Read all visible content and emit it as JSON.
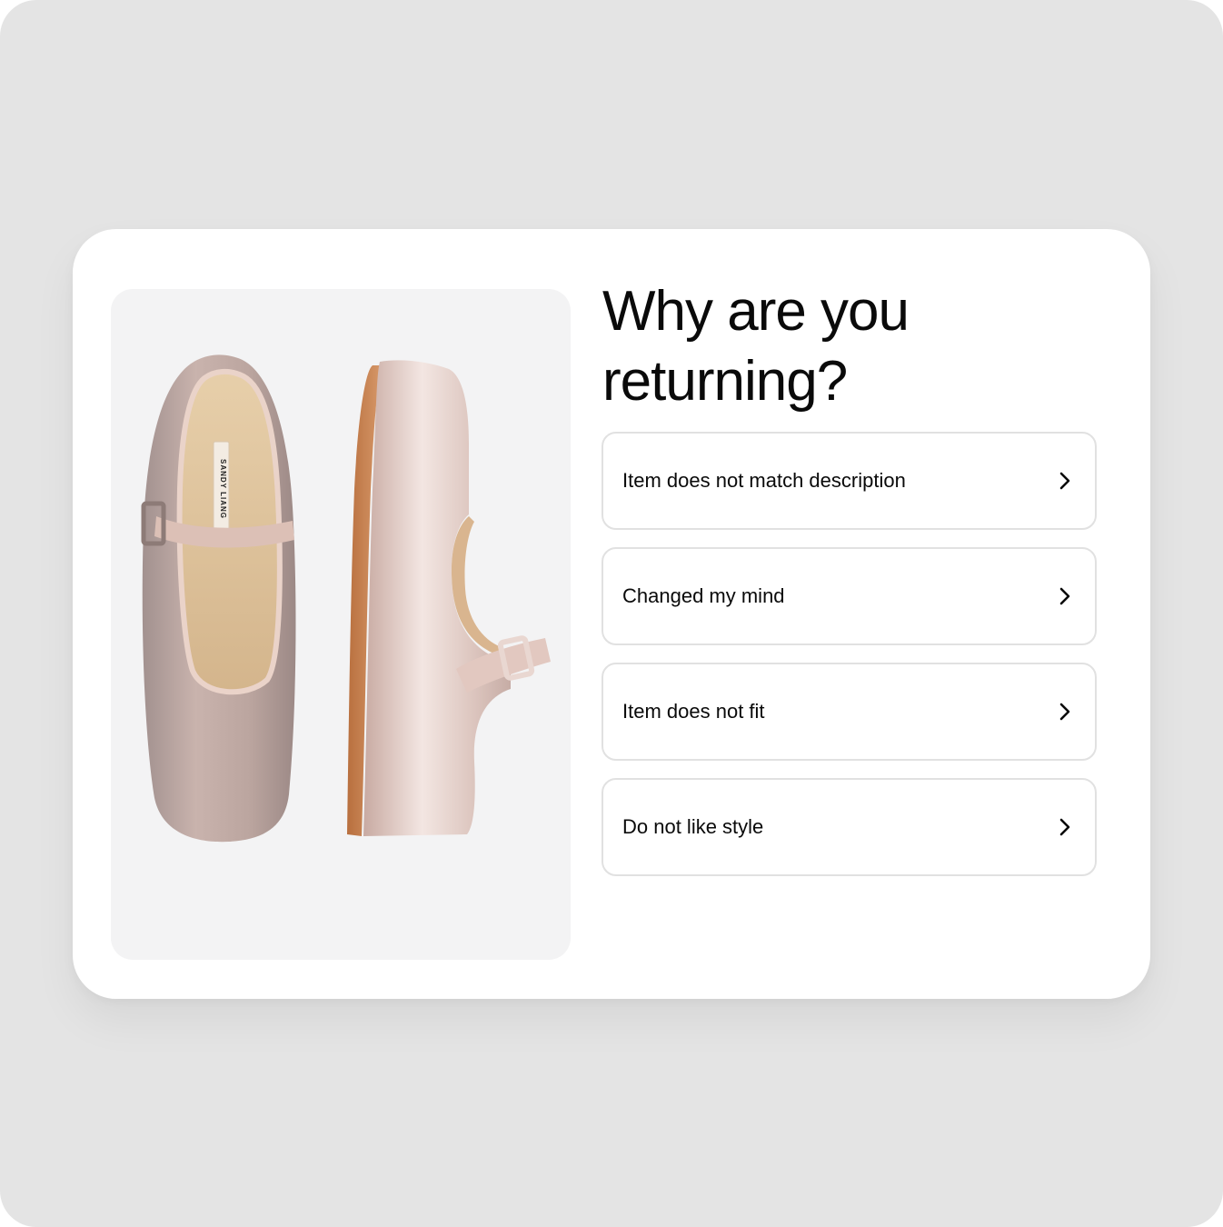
{
  "page": {
    "background_color": "#e4e4e4",
    "card_color": "#ffffff"
  },
  "product_image": {
    "description": "pink satin mary jane flats",
    "insole_brand_text": "SANDY LIANG"
  },
  "title": "Why are you returning?",
  "return_reasons": [
    {
      "label": "Item does not match description",
      "icon": "chevron-right-icon"
    },
    {
      "label": "Changed my mind",
      "icon": "chevron-right-icon"
    },
    {
      "label": "Item does not fit",
      "icon": "chevron-right-icon"
    },
    {
      "label": "Do not like style",
      "icon": "chevron-right-icon"
    }
  ]
}
